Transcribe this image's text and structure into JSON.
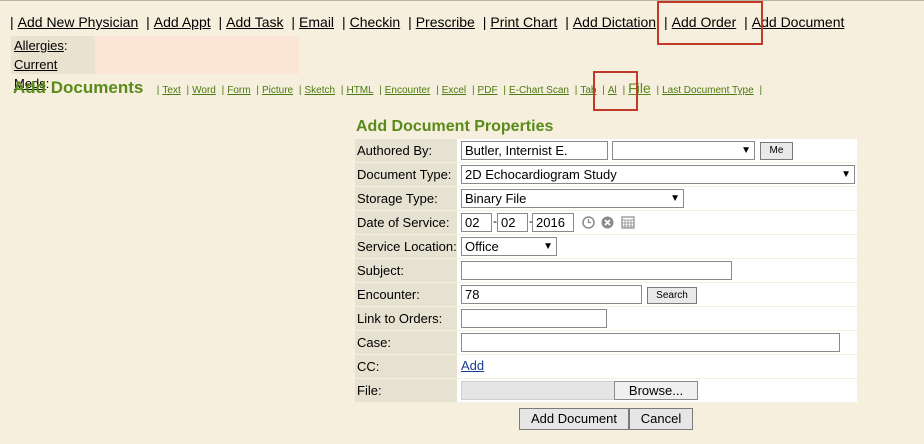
{
  "menu": {
    "items": [
      "Add New Physician",
      "Add Appt",
      "Add Task",
      "Email",
      "Checkin",
      "Prescribe",
      "Print Chart",
      "Add Dictation",
      "Add Order",
      "Add Document"
    ]
  },
  "patient_info": {
    "allergies_label": "Allergies",
    "current_meds_label": "Current Meds"
  },
  "add_documents": {
    "title": "Add Documents",
    "types": [
      "Text",
      "Word",
      "Form",
      "Picture",
      "Sketch",
      "HTML",
      "Encounter",
      "Excel",
      "PDF",
      "E-Chart Scan",
      "Tab",
      "Al",
      "File",
      "Last Document Type"
    ],
    "active_type": "File"
  },
  "form": {
    "title": "Add Document Properties",
    "authored_by": {
      "label": "Authored By:",
      "value": "Butler, Internist E.",
      "me_button": "Me"
    },
    "document_type": {
      "label": "Document Type:",
      "value": "2D Echocardiogram Study"
    },
    "storage_type": {
      "label": "Storage Type:",
      "value": "Binary File"
    },
    "date_of_service": {
      "label": "Date of Service:",
      "month": "02",
      "day": "02",
      "year": "2016"
    },
    "service_location": {
      "label": "Service Location:",
      "value": "Office"
    },
    "subject": {
      "label": "Subject:",
      "value": ""
    },
    "encounter": {
      "label": "Encounter:",
      "value": "78",
      "search_button": "Search"
    },
    "link_to_orders": {
      "label": "Link to Orders:",
      "value": ""
    },
    "case": {
      "label": "Case:",
      "value": ""
    },
    "cc": {
      "label": "CC:",
      "add_link": "Add"
    },
    "file": {
      "label": "File:",
      "browse_button": "Browse..."
    }
  },
  "actions": {
    "add_document": "Add Document",
    "cancel": "Cancel"
  },
  "colors": {
    "background": "#f6efdd",
    "heading_green": "#5a8a1a",
    "highlight_red": "#c0392b",
    "label_bg": "#e6e2d1"
  }
}
